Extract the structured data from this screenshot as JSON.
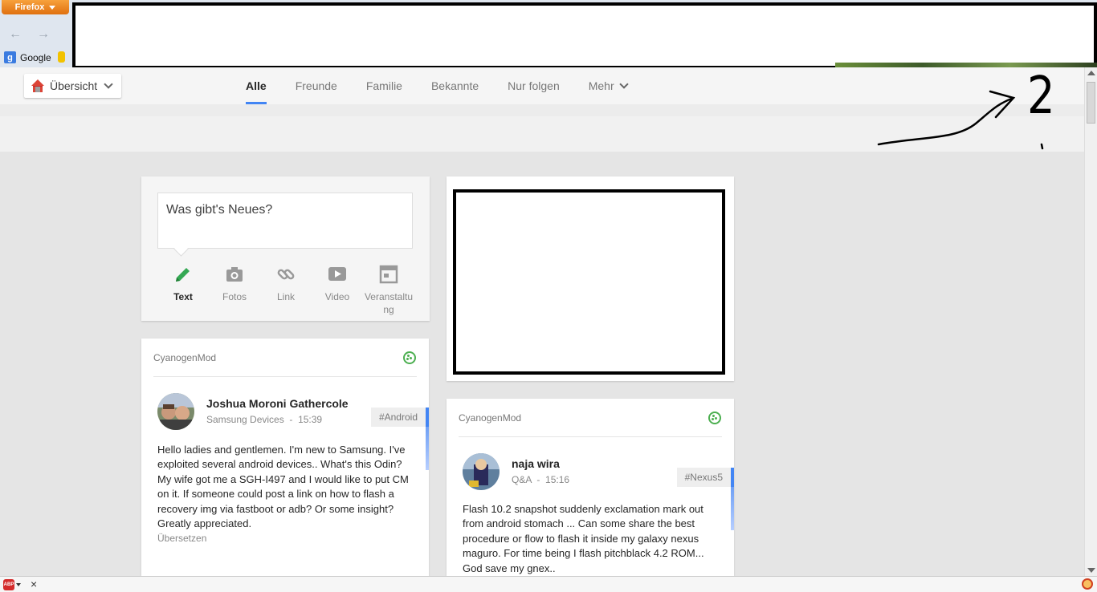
{
  "browser": {
    "menu_button": "Firefox",
    "bookmarks": [
      {
        "label": "Google"
      }
    ]
  },
  "header": {
    "overview_label": "Übersicht",
    "tabs": [
      {
        "label": "Alle",
        "active": true
      },
      {
        "label": "Freunde"
      },
      {
        "label": "Familie"
      },
      {
        "label": "Bekannte"
      },
      {
        "label": "Nur folgen"
      },
      {
        "label": "Mehr"
      }
    ]
  },
  "annotation": {
    "number": "2"
  },
  "compose": {
    "placeholder": "Was gibt's Neues?",
    "actions": [
      {
        "label": "Text",
        "icon": "pencil-icon",
        "active": true
      },
      {
        "label": "Fotos",
        "icon": "camera-icon"
      },
      {
        "label": "Link",
        "icon": "link-icon"
      },
      {
        "label": "Video",
        "icon": "video-icon"
      },
      {
        "label": "Veranstaltung",
        "icon": "calendar-icon"
      }
    ]
  },
  "posts": [
    {
      "community": "CyanogenMod",
      "author": "Joshua Moroni Gathercole",
      "category": "Samsung Devices",
      "time": "15:39",
      "tag": "#Android",
      "text": "Hello ladies and gentlemen. I'm new to Samsung. I've exploited several android devices.. What's this Odin? My wife got me a SGH-I497 and I would like to put CM on it. If someone could post a link on how to flash a recovery img via fastboot or adb? Or some insight? Greatly appreciated.",
      "translate": "Übersetzen"
    },
    {
      "community": "CyanogenMod",
      "author": "naja wira",
      "category": "Q&A",
      "time": "15:16",
      "tag": "#Nexus5",
      "text": "Flash 10.2 snapshot suddenly exclamation mark out from android stomach ... Can some share the best procedure or flow to flash it inside my galaxy nexus maguro. For time being I flash pitchblack 4.2 ROM... God save my gnex.."
    }
  ],
  "colors": {
    "accent": "#4285f4",
    "community": "#4caf50",
    "firefox": "#e8801c"
  }
}
